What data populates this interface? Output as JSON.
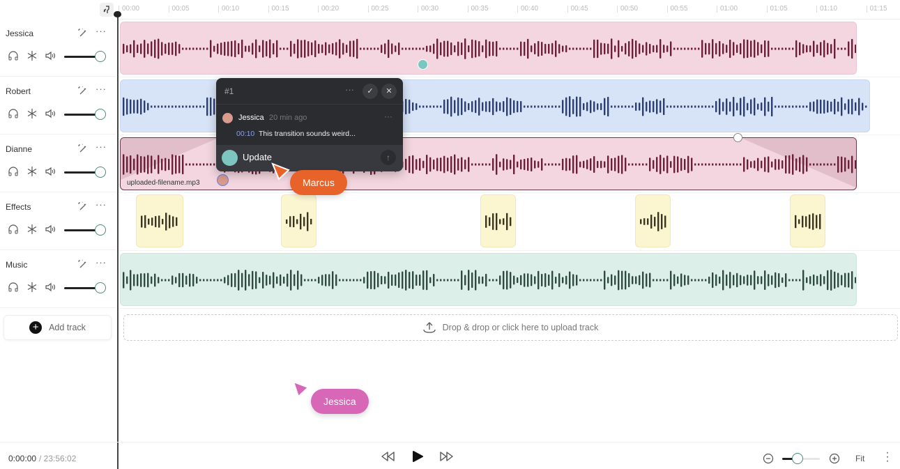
{
  "ruler": {
    "ticks": [
      "00:00",
      "00:05",
      "00:10",
      "00:15",
      "00:20",
      "00:25",
      "00:30",
      "00:35",
      "00:40",
      "00:45",
      "00:50",
      "00:55",
      "01:00",
      "01:05",
      "01:10",
      "01:15"
    ]
  },
  "tracks": [
    {
      "name": "Jessica",
      "volume": 1.0,
      "color": "#f3d6df",
      "wave": "#6b1f38"
    },
    {
      "name": "Robert",
      "volume": 1.0,
      "color": "#d7e4f7",
      "wave": "#2c3e6e"
    },
    {
      "name": "Dianne",
      "volume": 1.0,
      "color": "#f3d6df",
      "wave": "#6b1f38"
    },
    {
      "name": "Effects",
      "volume": 1.0,
      "color": "#fbf5d0",
      "wave": "#3a3520"
    },
    {
      "name": "Music",
      "volume": 1.0,
      "color": "#dcefe8",
      "wave": "#2f4a40"
    }
  ],
  "track_actions": {
    "more": "···"
  },
  "dianne_clip": {
    "filename": "uploaded-filename.mp3"
  },
  "add_track": {
    "label": "Add track",
    "icon": "+"
  },
  "drop_zone": {
    "label": "Drop & drop or click here to upload track"
  },
  "comment": {
    "id": "#1",
    "more": "···",
    "author": "Jessica",
    "time": "20 min ago",
    "timestamp": "00:10",
    "text": "This transition sounds weird...",
    "reply_value": "Update",
    "confirm": "✓",
    "close": "✕",
    "send": "↑"
  },
  "cursors": [
    {
      "name": "Marcus",
      "color": "#e8632a"
    },
    {
      "name": "Jessica",
      "color": "#d867b8"
    }
  ],
  "footer": {
    "current_time": "0:00:00",
    "total_time": "/ 23:56:02",
    "fit_label": "Fit",
    "zoom_level": 0.4
  }
}
